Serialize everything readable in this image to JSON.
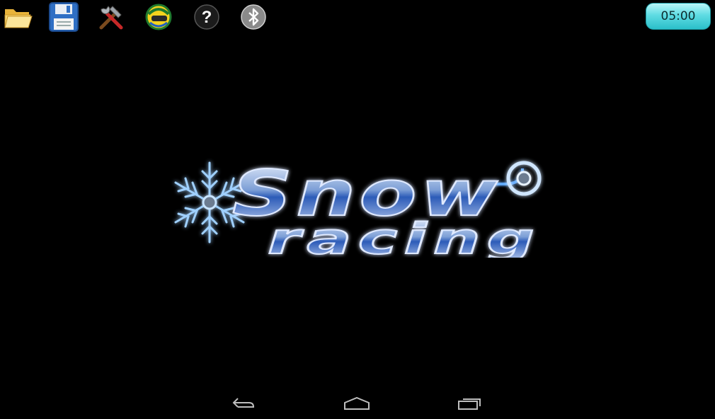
{
  "toolbar": {
    "items": [
      {
        "icon": "folder-open-icon"
      },
      {
        "icon": "save-disk-icon"
      },
      {
        "icon": "tools-icon"
      },
      {
        "icon": "helmet-icon"
      },
      {
        "icon": "help-icon"
      },
      {
        "icon": "bluetooth-icon"
      }
    ]
  },
  "timer": {
    "value": "05:00",
    "color": "#4fd6de"
  },
  "logo": {
    "line1": "Snow",
    "line2": "racing",
    "glow_color": "#3fa2ff"
  },
  "navbar": {
    "items": [
      {
        "icon": "back-icon"
      },
      {
        "icon": "home-icon"
      },
      {
        "icon": "recent-apps-icon"
      }
    ]
  }
}
